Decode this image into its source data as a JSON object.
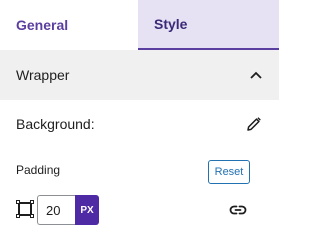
{
  "tabs": [
    {
      "label": "General",
      "active": false
    },
    {
      "label": "Style",
      "active": true
    }
  ],
  "section": {
    "title": "Wrapper",
    "expanded": true
  },
  "background": {
    "label": "Background:",
    "edit_icon": "pencil-icon"
  },
  "padding": {
    "label": "Padding",
    "reset_label": "Reset",
    "value": "20",
    "unit": "PX",
    "box_icon": "box-sides-icon",
    "link_icon": "link-icon"
  },
  "colors": {
    "accent": "#4f2aa5",
    "tab_active_bg": "#e6e1f3",
    "section_bg": "#f0f0f1",
    "reset_blue": "#2271b1"
  }
}
